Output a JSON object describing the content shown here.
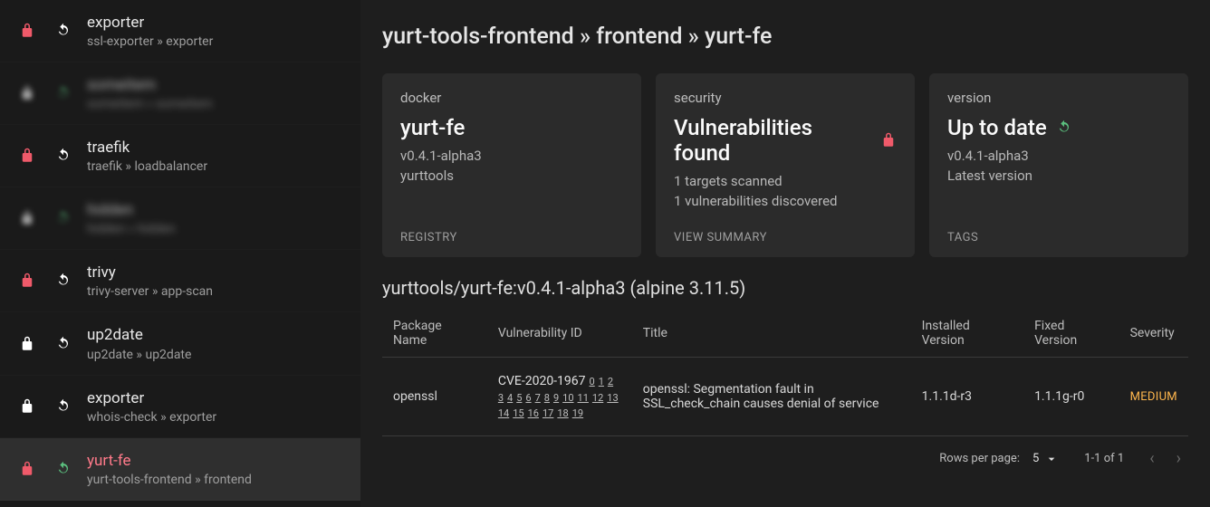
{
  "sidebar": {
    "items": [
      {
        "title": "exporter",
        "sub": "ssl-exporter » exporter",
        "lock": "red",
        "refresh": "white",
        "blurred": false,
        "selected": false
      },
      {
        "title": "someitem",
        "sub": "someitem » someitem",
        "lock": "white",
        "refresh": "green",
        "blurred": true,
        "selected": false
      },
      {
        "title": "traefik",
        "sub": "traefik » loadbalancer",
        "lock": "red",
        "refresh": "white",
        "blurred": false,
        "selected": false
      },
      {
        "title": "hidden",
        "sub": "hidden » hidden",
        "lock": "white",
        "refresh": "green",
        "blurred": true,
        "selected": false
      },
      {
        "title": "trivy",
        "sub": "trivy-server » app-scan",
        "lock": "red",
        "refresh": "white",
        "blurred": false,
        "selected": false
      },
      {
        "title": "up2date",
        "sub": "up2date » up2date",
        "lock": "white",
        "refresh": "white",
        "blurred": false,
        "selected": false
      },
      {
        "title": "exporter",
        "sub": "whois-check » exporter",
        "lock": "white",
        "refresh": "white",
        "blurred": false,
        "selected": false
      },
      {
        "title": "yurt-fe",
        "sub": "yurt-tools-frontend » frontend",
        "lock": "red",
        "refresh": "green",
        "blurred": false,
        "selected": true
      }
    ]
  },
  "breadcrumb": "yurt-tools-frontend » frontend » yurt-fe",
  "cards": {
    "docker": {
      "label": "docker",
      "title": "yurt-fe",
      "line1": "v0.4.1-alpha3",
      "line2": "yurttools",
      "footer": "REGISTRY"
    },
    "security": {
      "label": "security",
      "title": "Vulnerabilities found",
      "line1": "1 targets scanned",
      "line2": "1 vulnerabilities discovered",
      "footer": "VIEW SUMMARY"
    },
    "version": {
      "label": "version",
      "title": "Up to date",
      "line1": "v0.4.1-alpha3",
      "line2": "Latest version",
      "footer": "TAGS"
    }
  },
  "subheading": "yurttools/yurt-fe:v0.4.1-alpha3 (alpine 3.11.5)",
  "table": {
    "headers": {
      "package": "Package Name",
      "vuln": "Vulnerability ID",
      "title": "Title",
      "installed": "Installed Version",
      "fixed": "Fixed Version",
      "severity": "Severity"
    },
    "row": {
      "package": "openssl",
      "vulnId": "CVE-2020-1967",
      "refs": [
        "0",
        "1",
        "2",
        "3",
        "4",
        "5",
        "6",
        "7",
        "8",
        "9",
        "10",
        "11",
        "12",
        "13",
        "14",
        "15",
        "16",
        "17",
        "18",
        "19"
      ],
      "title": "openssl: Segmentation fault in SSL_check_chain causes denial of service",
      "installed": "1.1.1d-r3",
      "fixed": "1.1.1g-r0",
      "severity": "MEDIUM"
    }
  },
  "pagination": {
    "rowsLabel": "Rows per page:",
    "rows": "5",
    "range": "1-1 of 1"
  }
}
